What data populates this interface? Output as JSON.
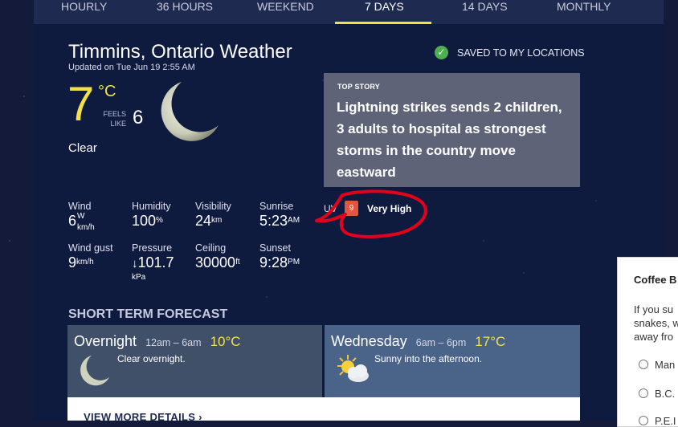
{
  "tabs": [
    {
      "label": "HOURLY",
      "active": false
    },
    {
      "label": "36 HOURS",
      "active": false
    },
    {
      "label": "WEEKEND",
      "active": false
    },
    {
      "label": "7 DAYS",
      "active": true
    },
    {
      "label": "14 DAYS",
      "active": false
    },
    {
      "label": "MONTHLY",
      "active": false
    }
  ],
  "location": {
    "title": "Timmins, Ontario Weather",
    "updated": "Updated on Tue Jun 19 2:55 AM",
    "saved_label": "SAVED TO MY LOCATIONS"
  },
  "current": {
    "temp": "7",
    "unit": "°C",
    "feels_label_1": "FEELS",
    "feels_label_2": "LIKE",
    "feels_value": "6",
    "condition": "Clear",
    "icon": "crescent-moon-icon"
  },
  "top_story": {
    "tag": "TOP STORY",
    "title": "Lightning strikes sends 2 children, 3 adults to hospital as strongest storms in the country move eastward"
  },
  "stats": {
    "wind": {
      "label": "Wind",
      "value": "6",
      "unit_top": "W",
      "unit_bottom": "km/h"
    },
    "humidity": {
      "label": "Humidity",
      "value": "100",
      "unit": "%"
    },
    "visibility": {
      "label": "Visibility",
      "value": "24",
      "unit": "km"
    },
    "sunrise": {
      "label": "Sunrise",
      "value": "5:23",
      "unit": "AM"
    },
    "wind_gust": {
      "label": "Wind gust",
      "value": "9",
      "unit": "km/h"
    },
    "pressure": {
      "label": "Pressure",
      "arrow": "↓",
      "value": "101.7",
      "unit": "kPa"
    },
    "ceiling": {
      "label": "Ceiling",
      "value": "30000",
      "unit": "ft"
    },
    "sunset": {
      "label": "Sunset",
      "value": "9:28",
      "unit": "PM"
    }
  },
  "uv": {
    "label": "UV",
    "index": "9",
    "level": "Very High",
    "badge_color": "#e2553f"
  },
  "short_term": {
    "title": "SHORT TERM FORECAST",
    "cards": [
      {
        "day": "Overnight",
        "time": "12am – 6am",
        "temp": "10°C",
        "desc": "Clear overnight.",
        "icon": "crescent-moon-icon"
      },
      {
        "day": "Wednesday",
        "time": "6am – 6pm",
        "temp": "17°C",
        "desc": "Sunny into the afternoon.",
        "icon": "sun-cloud-icon"
      }
    ],
    "more_label": "VIEW MORE DETAILS ›"
  },
  "poll": {
    "title": "Coffee B",
    "text_lines": [
      "If you su",
      "snakes, w",
      "away fro"
    ],
    "options": [
      "Man",
      "B.C.",
      "P.E.I"
    ]
  },
  "colors": {
    "accent": "#f2e04a",
    "panel": "#0f1a3f",
    "annotation": "#e3001b"
  }
}
